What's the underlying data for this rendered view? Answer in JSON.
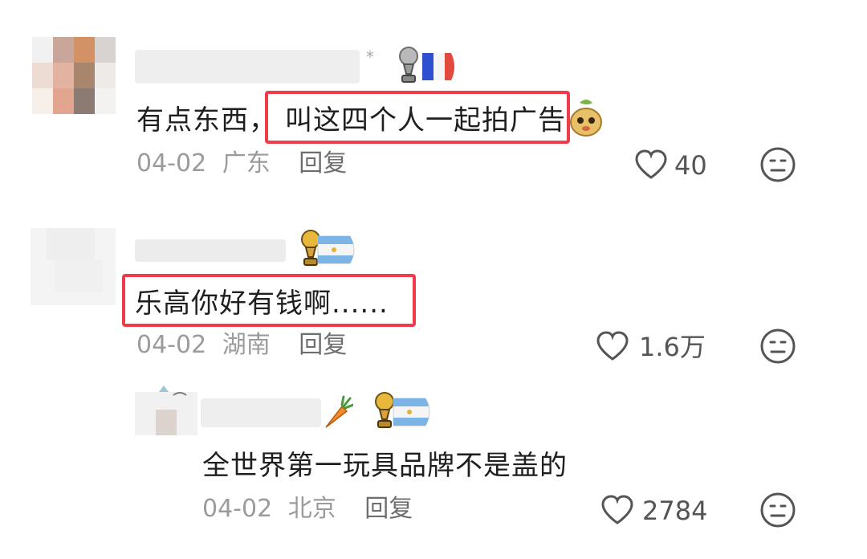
{
  "colors": {
    "highlight": "#ef3b4c",
    "meta": "#9b9b9b",
    "reply": "#6e6e6e"
  },
  "comments": [
    {
      "text_prefix": "有点东西，",
      "text_highlight": "叫这四个人一起拍广告",
      "date": "04-02",
      "location": "广东",
      "reply_label": "回复",
      "likes": "40",
      "badges": [
        "trophy-icon",
        "france-flag-icon"
      ],
      "emoji": "meerkat-emoji-icon"
    },
    {
      "text_highlight": "乐高你好有钱啊......",
      "date": "04-02",
      "location": "湖南",
      "reply_label": "回复",
      "likes": "1.6万",
      "badges": [
        "trophy-icon",
        "argentina-flag-icon"
      ]
    },
    {
      "text": "全世界第一玩具品牌不是盖的",
      "date": "04-02",
      "location": "北京",
      "reply_label": "回复",
      "likes": "2784",
      "badges": [
        "carrot-icon",
        "trophy-icon",
        "argentina-flag-icon"
      ]
    }
  ]
}
